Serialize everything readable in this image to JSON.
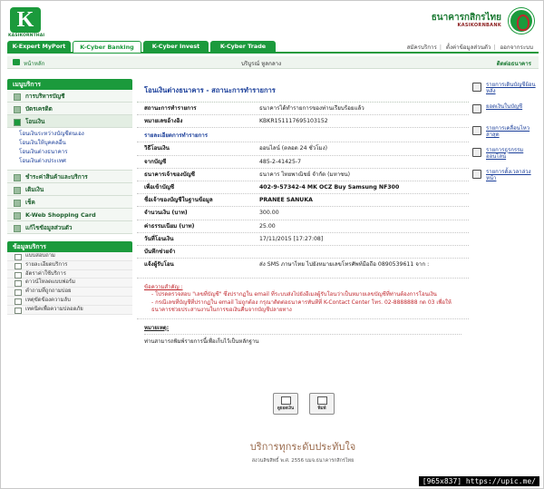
{
  "header": {
    "logo_text": "KASIKORNTHAI",
    "bank_name": "ธนาคารกสิกรไทย",
    "bank_sub": "KASIKORNBANK"
  },
  "tabs": [
    {
      "label": "K-Expert MyPort"
    },
    {
      "label": "K-Cyber Banking"
    },
    {
      "label": "K-Cyber Invest"
    },
    {
      "label": "K-Cyber Trade"
    }
  ],
  "toplinks": {
    "apply": "สมัครบริการ",
    "settings": "ตั้งค่าข้อมูลส่วนตัว",
    "logout": "ออกจากระบบ"
  },
  "subbar": {
    "home": "หน้าหลัก",
    "user": "บริบูรณ์ หูลกลาง",
    "contact": "ติดต่อธนาคาร"
  },
  "sidebar": {
    "menu_title": "เมนูบริการ",
    "items": [
      {
        "label": "การบริหารบัญชี"
      },
      {
        "label": "บัตรเครดิต"
      },
      {
        "label": "โอนเงิน"
      }
    ],
    "transfer_sub": [
      {
        "label": "โอนเงินระหว่างบัญชีตนเอง"
      },
      {
        "label": "โอนเงินให้บุคคลอื่น"
      },
      {
        "label": "โอนเงินต่างธนาคาร"
      },
      {
        "label": "โอนเงินต่างประเทศ"
      }
    ],
    "items2": [
      {
        "label": "ชำระค่าสินค้าและบริการ"
      },
      {
        "label": "เติมเงิน"
      },
      {
        "label": "เช็ค"
      },
      {
        "label": "K-Web Shopping Card"
      },
      {
        "label": "แก้ไขข้อมูลส่วนตัว"
      }
    ],
    "tools_title": "ข้อมูลบริการ",
    "tools": [
      {
        "label": "แบบสอบถาม"
      },
      {
        "label": "รายละเอียดบริการ"
      },
      {
        "label": "อัตราค่าใช้บริการ"
      },
      {
        "label": "ดาวน์โหลดแบบฟอร์ม"
      },
      {
        "label": "คำถามที่ถูกถามบ่อย"
      },
      {
        "label": "เหตุขัดข้องความลับ"
      },
      {
        "label": "เทคนิคเพื่อความปลอดภัย"
      }
    ]
  },
  "main": {
    "title": "โอนเงินต่างธนาคาร - สถานะการทำรายการ",
    "status_rows": [
      {
        "label": "สถานะการทำรายการ",
        "value": "ธนาคารได้ทำรายการของท่านเรียบร้อยแล้ว"
      },
      {
        "label": "หมายเลขอ้างอิง",
        "value": "KBKR151117695103152"
      }
    ],
    "detail_title": "รายละเอียดการทำรายการ",
    "detail_rows": [
      {
        "label": "วิธีโอนเงิน",
        "value": "ออนไลน์ (ตลอด 24 ชั่วโมง)"
      },
      {
        "label": "จากบัญชี",
        "value": "485-2-41425-7"
      },
      {
        "label": "ธนาคารเจ้าของบัญชี",
        "value": "ธนาคาร ไทยพาณิชย์ จำกัด (มหาชน)"
      },
      {
        "label": "เพื่อเข้าบัญชี",
        "value": "402-9-57342-4 MK OCZ Buy Samsung NF300",
        "bold": true
      },
      {
        "label": "ชื่อเจ้าของบัญชีในฐานข้อมูล",
        "value": "PRANEE SANUKA",
        "bold": true
      },
      {
        "label": "จำนวนเงิน (บาท)",
        "value": "300.00"
      },
      {
        "label": "ค่าธรรมเนียม (บาท)",
        "value": "25.00"
      },
      {
        "label": "วันที่โอนเงิน",
        "value": "17/11/2015 [17:27:08]"
      },
      {
        "label": "บันทึกช่วยจำ",
        "value": ""
      }
    ],
    "notify_label": "แจ้งผู้รับโอน",
    "notify_value": "ส่ง SMS ภาษาไทย ไปยังหมายเลขโทรศัพท์มือถือ 0890539611 จาก :",
    "note_title": "ข้อความสำคัญ :",
    "note_lines": [
      "- โปรดตรวจสอบ \"เลขที่บัญชี\" ซึ่งปรากฏใน email ที่ระบบส่งไปยังอีเมลผู้รับโอนว่าเป็นหมายเลขบัญชีที่ท่านต้องการโอนเงิน",
      "- กรณีเลขที่บัญชีที่ปรากฏใน email ไม่ถูกต้อง กรุณาติดต่อธนาคารทันทีที่ K-Contact Center โทร. 02-8888888 กด 03 เพื่อให้ธนาคารช่วยประสานงานในการขอเงินคืนจากบัญชีปลายทาง"
    ],
    "remark_title": "หมายเหตุ:",
    "remark_text": "ท่านสามารถพิมพ์รายการนี้เพื่อเก็บไว้เป็นหลักฐาน"
  },
  "buttons": {
    "back": "ดูยอดเงิน",
    "print": "พิมพ์"
  },
  "right": [
    {
      "label": "รายการเดินบัญชีย้อนหลัง"
    },
    {
      "label": "ยอดเงินในบัญชี"
    },
    {
      "label": "รายการเคลื่อนไหวล่าสุด"
    },
    {
      "label": "รายการธุรกรรมออนไลน์"
    },
    {
      "label": "รายการตั้งเวลาล่วงหน้า"
    }
  ],
  "footer": {
    "title": "บริการทุกระดับประทับใจ",
    "copyright": "สงวนลิขสิทธิ์ พ.ศ. 2556 บมจ.ธนาคารกสิกรไทย"
  },
  "watermark": "[965x837] https://upic.me/"
}
